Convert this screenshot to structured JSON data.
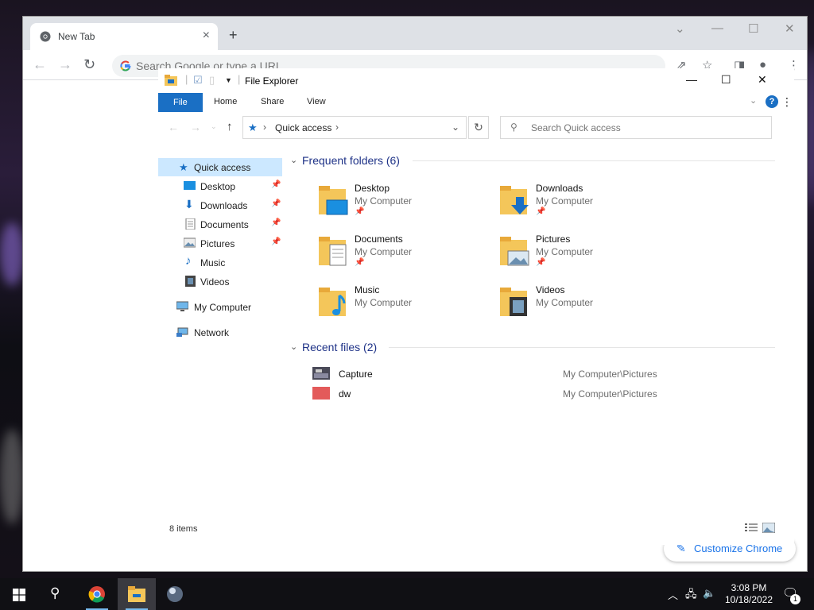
{
  "chrome": {
    "tab_title": "New Tab",
    "omnibox_placeholder": "Search Google or type a URL",
    "customize_label": "Customize Chrome"
  },
  "explorer": {
    "title": "File Explorer",
    "ribbon_tabs": [
      "File",
      "Home",
      "Share",
      "View"
    ],
    "help_label": "?",
    "address_crumb": "Quick access",
    "search_placeholder": "Search Quick access",
    "nav": {
      "quick_access": "Quick access",
      "desktop": "Desktop",
      "downloads": "Downloads",
      "documents": "Documents",
      "pictures": "Pictures",
      "music": "Music",
      "videos": "Videos",
      "my_computer": "My Computer",
      "network": "Network"
    },
    "frequent_heading": "Frequent folders (6)",
    "folders": [
      {
        "name": "Desktop",
        "location": "My Computer",
        "pinned": true
      },
      {
        "name": "Downloads",
        "location": "My Computer",
        "pinned": true
      },
      {
        "name": "Documents",
        "location": "My Computer",
        "pinned": true
      },
      {
        "name": "Pictures",
        "location": "My Computer",
        "pinned": true
      },
      {
        "name": "Music",
        "location": "My Computer",
        "pinned": false
      },
      {
        "name": "Videos",
        "location": "My Computer",
        "pinned": false
      }
    ],
    "recent_heading": "Recent files (2)",
    "recent_files": [
      {
        "name": "Capture",
        "path": "My Computer\\Pictures"
      },
      {
        "name": "dw",
        "path": "My Computer\\Pictures"
      }
    ],
    "status": "8 items"
  },
  "taskbar": {
    "time": "3:08 PM",
    "date": "10/18/2022",
    "notification_count": "1"
  },
  "colors": {
    "accent": "#1a6fc4",
    "selected": "#cce8ff",
    "folder": "#f4c65a",
    "heading": "#1e3287"
  }
}
